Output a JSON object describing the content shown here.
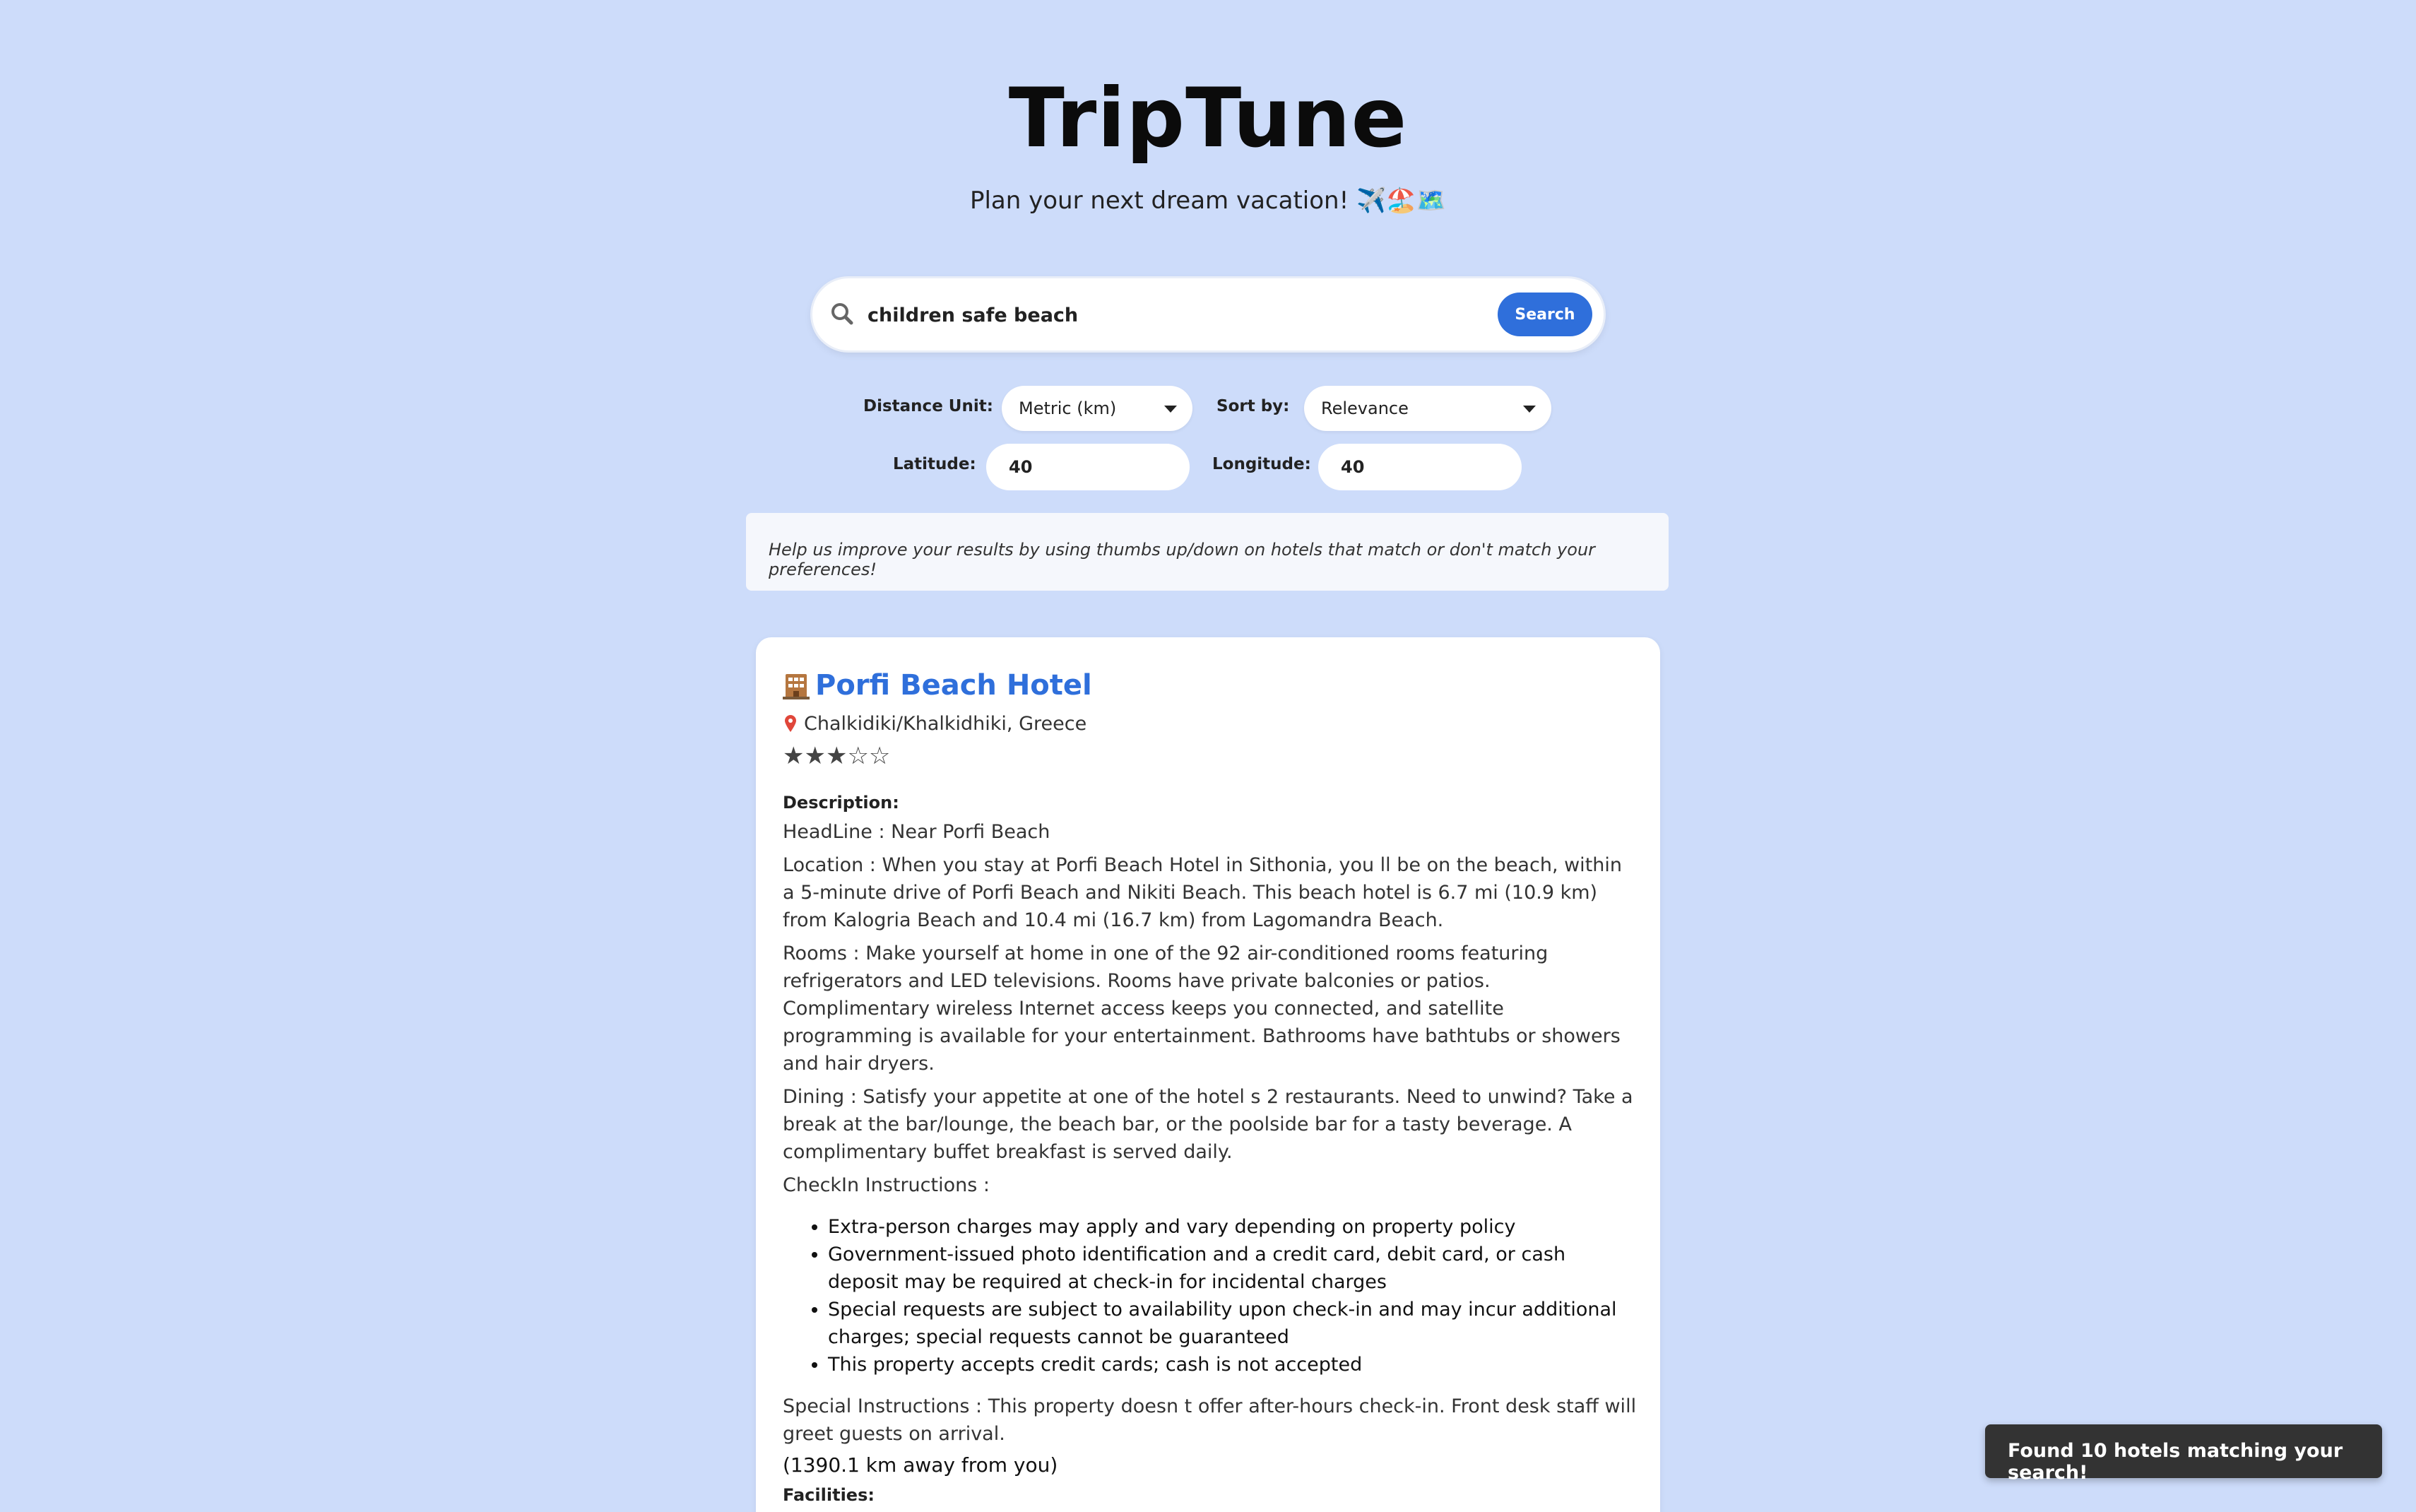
{
  "header": {
    "title": "TripTune",
    "subtitle": "Plan your next dream vacation! ✈️🏖️🗺️"
  },
  "search": {
    "value": "children safe beach",
    "button_label": "Search"
  },
  "filters": {
    "distance_unit_label": "Distance Unit:",
    "distance_unit_value": "Metric (km)",
    "sort_label": "Sort by:",
    "sort_value": "Relevance",
    "latitude_label": "Latitude:",
    "latitude_value": "40",
    "longitude_label": "Longitude:",
    "longitude_value": "40"
  },
  "notice": "Help us improve your results by using thumbs up/down on hotels that match or don't match your preferences!",
  "hotel": {
    "name": "Porfi Beach Hotel",
    "location": "Chalkidiki/Khalkidhiki, Greece",
    "stars": "★★★☆☆",
    "rating": 3,
    "description_label": "Description:",
    "headline": "HeadLine : Near Porfi Beach",
    "location_desc": "Location : When you stay at Porfi Beach Hotel in Sithonia, you ll be on the beach, within a 5-minute drive of Porfi Beach and Nikiti Beach. This beach hotel is 6.7 mi (10.9 km) from Kalogria Beach and 10.4 mi (16.7 km) from Lagomandra Beach.",
    "rooms": "Rooms : Make yourself at home in one of the 92 air-conditioned rooms featuring refrigerators and LED televisions. Rooms have private balconies or patios. Complimentary wireless Internet access keeps you connected, and satellite programming is available for your entertainment. Bathrooms have bathtubs or showers and hair dryers.",
    "dining": "Dining : Satisfy your appetite at one of the hotel s 2 restaurants. Need to unwind? Take a break at the bar/lounge, the beach bar, or the poolside bar for a tasty beverage. A complimentary buffet breakfast is served daily.",
    "checkin_label": "CheckIn Instructions :",
    "checkin_items": [
      "Extra-person charges may apply and vary depending on property policy",
      "Government-issued photo identification and a credit card, debit card, or cash deposit may be required at check-in for incidental charges",
      "Special requests are subject to availability upon check-in and may incur additional charges; special requests cannot be guaranteed",
      "This property accepts credit cards; cash is not accepted"
    ],
    "special": "Special Instructions : This property doesn t offer after-hours check-in. Front desk staff will greet guests on arrival.",
    "distance": "(1390.1 km away from you)",
    "facilities_label": "Facilities:"
  },
  "toast": "Found 10 hotels matching your search!",
  "colors": {
    "background": "#cddcfa",
    "accent": "#2f6fdb",
    "toast_bg": "#333333"
  },
  "icons": {
    "search": "search-icon",
    "hotel": "hotel-icon",
    "pin": "map-pin-icon"
  }
}
